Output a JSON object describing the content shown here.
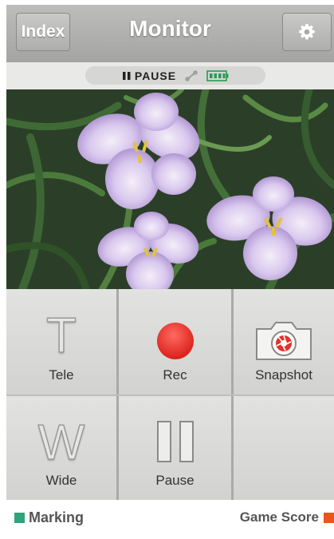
{
  "header": {
    "index_label": "Index",
    "title": "Monitor",
    "settings_icon": "gear-icon"
  },
  "status": {
    "state_text": "PAUSE",
    "pause_icon": "pause-icon",
    "link_icon": "link-icon",
    "battery_icon": "battery-icon"
  },
  "controls": {
    "tele_label": "Tele",
    "rec_label": "Rec",
    "snapshot_label": "Snapshot",
    "wide_label": "Wide",
    "pause_label": "Pause",
    "tele_glyph": "T",
    "wide_glyph": "W"
  },
  "footer": {
    "marking_label": "Marking",
    "game_score_label": "Game Score"
  },
  "colors": {
    "header_bg": "#a8a8a6",
    "rec_red": "#e8302c",
    "marking_green": "#2fa37a",
    "game_score_orange": "#e8561c"
  }
}
